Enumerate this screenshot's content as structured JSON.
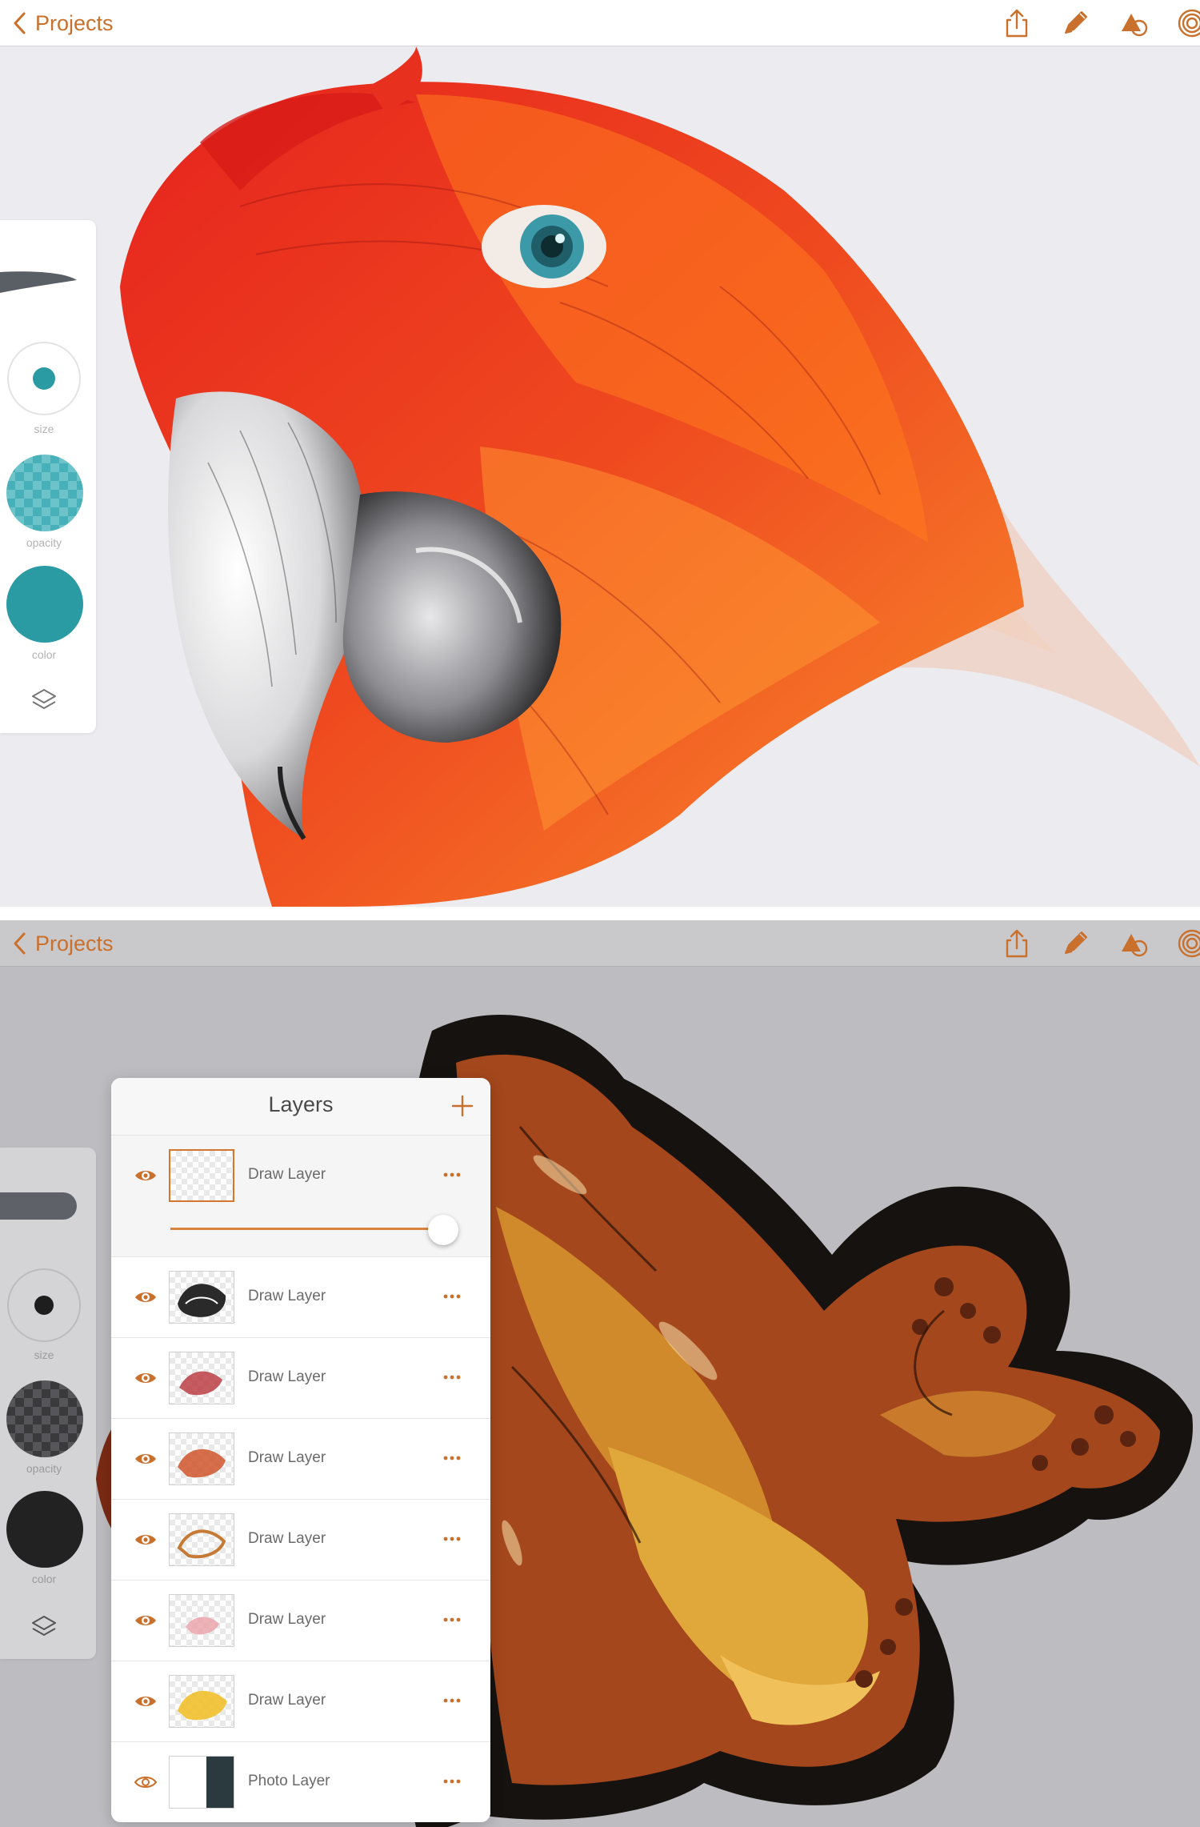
{
  "colors": {
    "accent": "#c9702c",
    "teal": "#2a9aa3",
    "dark_swatch": "#222222"
  },
  "screen1": {
    "nav": {
      "back_label": "Projects",
      "back_icon": "chevron-left-icon",
      "tools": [
        "share-icon",
        "pencil-icon",
        "shapes-icon",
        "capture-icon",
        "fullscreen-icon"
      ]
    },
    "sidebar": {
      "size_label": "size",
      "opacity_label": "opacity",
      "color_label": "color",
      "layers_icon": "layers-icon",
      "color_value": "#2a9aa3"
    },
    "artwork": "parrot-illustration"
  },
  "screen2": {
    "nav": {
      "back_label": "Projects",
      "back_icon": "chevron-left-icon",
      "tools": [
        "share-icon",
        "pencil-icon",
        "shapes-icon",
        "capture-icon",
        "fullscreen-icon"
      ]
    },
    "sidebar": {
      "size_label": "size",
      "opacity_label": "opacity",
      "color_label": "color",
      "layers_icon": "layers-icon",
      "color_value": "#222222"
    },
    "layers_panel": {
      "title": "Layers",
      "add_icon": "plus-icon",
      "selected_opacity": 0.95,
      "items": [
        {
          "name": "Draw Layer",
          "thumb": "empty",
          "visible": true,
          "selected": true
        },
        {
          "name": "Draw Layer",
          "thumb": "octopus-ink",
          "visible": true
        },
        {
          "name": "Draw Layer",
          "thumb": "red-sketch",
          "visible": true
        },
        {
          "name": "Draw Layer",
          "thumb": "red-orange",
          "visible": true
        },
        {
          "name": "Draw Layer",
          "thumb": "orange-outline",
          "visible": true
        },
        {
          "name": "Draw Layer",
          "thumb": "pink-light",
          "visible": true
        },
        {
          "name": "Draw Layer",
          "thumb": "yellow",
          "visible": true
        },
        {
          "name": "Photo Layer",
          "thumb": "photo",
          "visible": true
        }
      ]
    },
    "artwork": "octopus-illustration"
  }
}
